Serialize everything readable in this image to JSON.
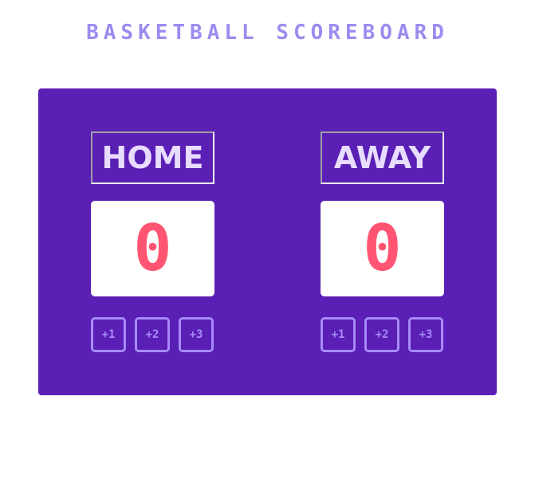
{
  "app": {
    "title": "BASKETBALL SCOREBOARD"
  },
  "teams": [
    {
      "name": "HOME",
      "score": "0",
      "buttons": [
        "+1",
        "+2",
        "+3"
      ]
    },
    {
      "name": "AWAY",
      "score": "0",
      "buttons": [
        "+1",
        "+2",
        "+3"
      ]
    }
  ],
  "colors": {
    "title": "#9b8cf0",
    "board_background": "#5a1fb4",
    "team_name_text": "#e8dcff",
    "score_digits": "#ff5572",
    "score_box": "#ffffff",
    "button_outline": "#a78bfa"
  }
}
